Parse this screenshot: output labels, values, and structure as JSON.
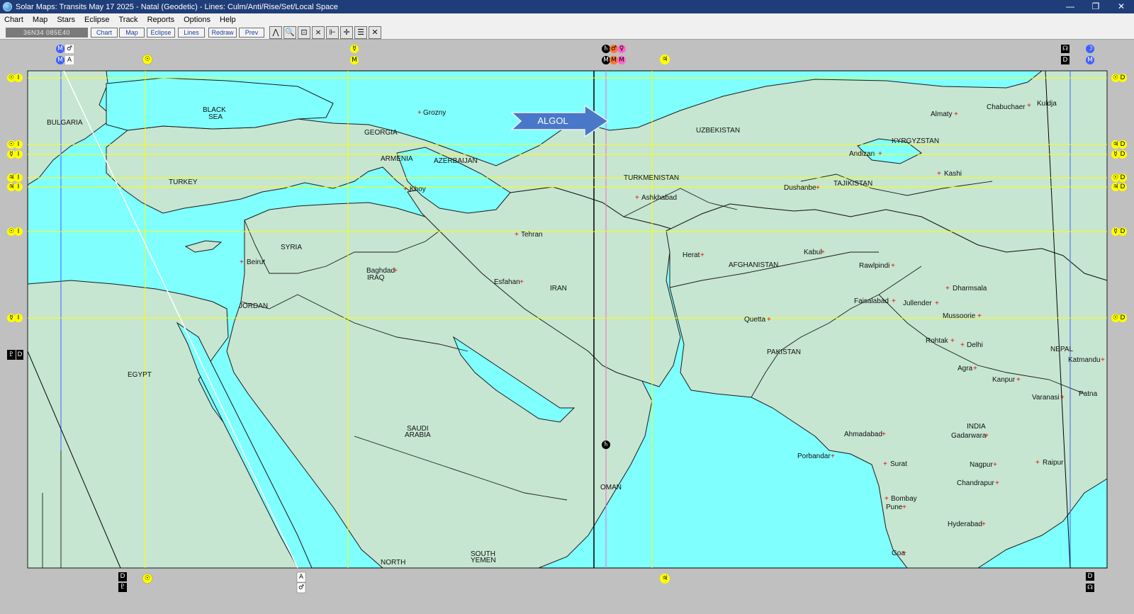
{
  "window": {
    "title": "Solar Maps: Transits May 17 2025 - Natal (Geodetic) - Lines: Culm/Anti/Rise/Set/Local Space",
    "minimize": "—",
    "maximize": "❐",
    "close": "✕"
  },
  "menu": [
    "Chart",
    "Map",
    "Stars",
    "Eclipse",
    "Track",
    "Reports",
    "Options",
    "Help"
  ],
  "toolbar": {
    "coordinates": "36N34 085E40",
    "buttons": [
      "Chart",
      "Map",
      "Eclipse",
      "Lines",
      "Redraw",
      "Prev"
    ],
    "icons": [
      {
        "name": "compass-icon",
        "glyph": "⋀"
      },
      {
        "name": "zoom-icon",
        "glyph": "🔍"
      },
      {
        "name": "fit-icon",
        "glyph": "⊡"
      },
      {
        "name": "clear-icon",
        "glyph": "⨯"
      },
      {
        "name": "measure-icon",
        "glyph": "⊩"
      },
      {
        "name": "crosshair-icon",
        "glyph": "✛"
      },
      {
        "name": "legend-icon",
        "glyph": "☰"
      },
      {
        "name": "lines-icon",
        "glyph": "✕"
      }
    ]
  },
  "map": {
    "annotation": "ALGOL",
    "colors": {
      "sea": "#80ffff",
      "land": "#c6e6d1",
      "border": "#1a1a1a",
      "culm_line": "#ffff00",
      "frame": "#c0c0c0"
    },
    "countries": [
      {
        "name": "BULGARIA"
      },
      {
        "name": "BLACK"
      },
      {
        "name": "SEA"
      },
      {
        "name": "GEORGIA"
      },
      {
        "name": "ARMENIA"
      },
      {
        "name": "AZERBAIJAN"
      },
      {
        "name": "TURKEY"
      },
      {
        "name": "UZBEKISTAN"
      },
      {
        "name": "KYRGYZSTAN"
      },
      {
        "name": "TURKMENISTAN"
      },
      {
        "name": "TAJIKISTAN"
      },
      {
        "name": "SYRIA"
      },
      {
        "name": "AFGHANISTAN"
      },
      {
        "name": "IRAQ"
      },
      {
        "name": "IRAN"
      },
      {
        "name": "JORDAN"
      },
      {
        "name": "PAKISTAN"
      },
      {
        "name": "NEPAL"
      },
      {
        "name": "EGYPT"
      },
      {
        "name": "SAUDI"
      },
      {
        "name": "ARABIA"
      },
      {
        "name": "INDIA"
      },
      {
        "name": "OMAN"
      },
      {
        "name": "SOUTH"
      },
      {
        "name": "YEMEN"
      },
      {
        "name": "NORTH"
      },
      {
        "name": "YEMEN"
      }
    ],
    "cities": [
      {
        "name": "Grozny"
      },
      {
        "name": "Almaty"
      },
      {
        "name": "Chabuchaer"
      },
      {
        "name": "Kuldja"
      },
      {
        "name": "Andizan"
      },
      {
        "name": "Kashi"
      },
      {
        "name": "Khoy"
      },
      {
        "name": "Ashkhabad"
      },
      {
        "name": "Dushanbe"
      },
      {
        "name": "Tehran"
      },
      {
        "name": "Herat"
      },
      {
        "name": "Kabul"
      },
      {
        "name": "Beirut"
      },
      {
        "name": "Baghdad"
      },
      {
        "name": "Rawlpindi"
      },
      {
        "name": "Esfahan"
      },
      {
        "name": "Dharmsala"
      },
      {
        "name": "Faisalabad"
      },
      {
        "name": "Jullender"
      },
      {
        "name": "Quetta"
      },
      {
        "name": "Mussoorie"
      },
      {
        "name": "Rohtak"
      },
      {
        "name": "Delhi"
      },
      {
        "name": "Katmandu"
      },
      {
        "name": "Agra"
      },
      {
        "name": "Kanpur"
      },
      {
        "name": "Patna"
      },
      {
        "name": "Varanasi"
      },
      {
        "name": "Ahmadabad"
      },
      {
        "name": "Gadarwara"
      },
      {
        "name": "Porbandar"
      },
      {
        "name": "Surat"
      },
      {
        "name": "Nagpur"
      },
      {
        "name": "Raipur"
      },
      {
        "name": "Chandrapur"
      },
      {
        "name": "Bombay"
      },
      {
        "name": "Pune"
      },
      {
        "name": "Hyderabad"
      },
      {
        "name": "Goa"
      }
    ],
    "planet_glyphs": {
      "mars": "♂",
      "sun": "☉",
      "moon": "☽",
      "mercury": "☿",
      "venus": "♀",
      "jupiter": "♃",
      "saturn": "♄",
      "uranus": "♅",
      "neptune": "♆",
      "pluto": "♇",
      "node": "☊",
      "mc": "M",
      "asc": "A",
      "dsc": "D",
      "ic": "I"
    }
  }
}
